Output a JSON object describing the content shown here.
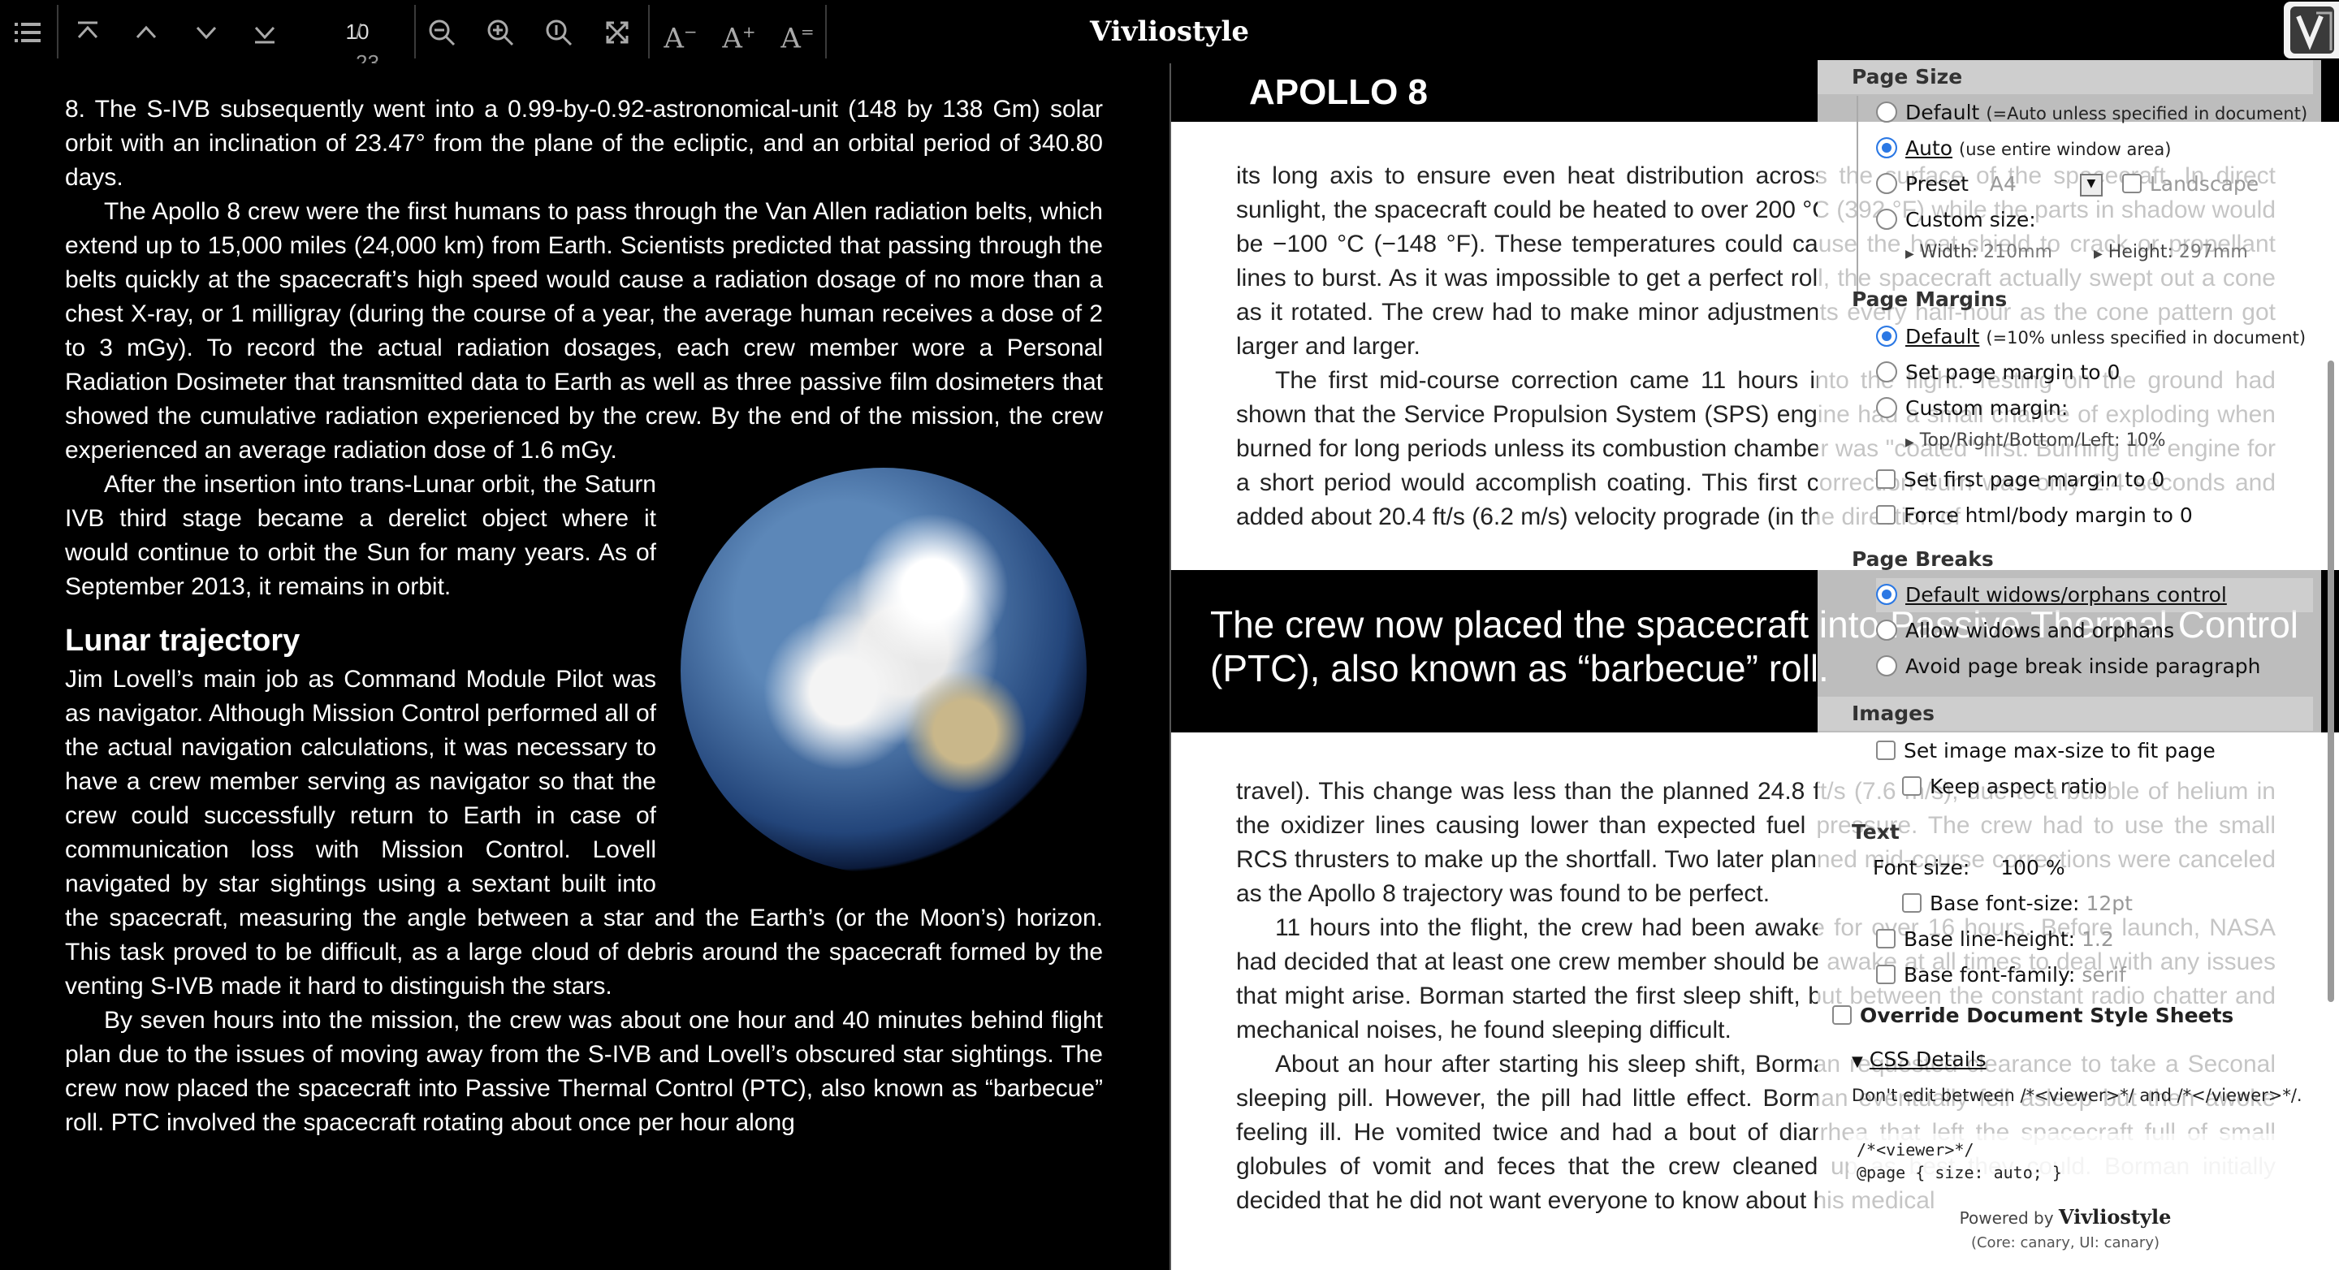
{
  "toolbar": {
    "page_current": "10",
    "page_total": "/ 23",
    "title": "Vivliostyle",
    "icons": [
      "menu-icon",
      "first-page-icon",
      "prev-page-icon",
      "next-page-icon",
      "last-page-icon",
      "zoom-out-icon",
      "zoom-in-icon",
      "zoom-actual-icon",
      "fit-page-icon",
      "font-smaller-icon",
      "font-larger-icon",
      "font-reset-icon"
    ]
  },
  "left_page": {
    "p1": "8. The S-IVB subsequently went into a 0.99-by-0.92-astronomical-unit (148 by 138 Gm) solar orbit with an inclination of 23.47° from the plane of the ecliptic, and an orbital period of 340.80 days.",
    "p2": "The Apollo 8 crew were the first humans to pass through the Van Allen radiation belts, which extend up to 15,000 miles (24,000 km) from Earth. Scientists predicted that passing through the belts quickly at the spacecraft’s high speed would cause a radiation dosage of no more than a chest X-ray, or 1 milligray (during the course of a year, the average human receives a dose of 2 to 3 mGy). To record the actual radiation dosages, each crew member wore a Personal Radiation Dosimeter that transmitted data to Earth as well as three passive film dosimeters that showed the cumulative radiation experienced by the crew. By the end of the mission, the crew experienced an average radiation dose of 1.6 mGy.",
    "p3": "After the insertion into trans-Lunar orbit, the Saturn IVB third stage became a derelict object where it would continue to orbit the Sun for many years. As of September 2013, it remains in orbit.",
    "heading": "Lunar trajectory",
    "p4": "Jim Lovell’s main job as Command Module Pilot was as navigator. Although Mission Control performed all of the actual navigation calculations, it was necessary to have a crew member serving as navigator so that the crew could successfully return to Earth in case of communication loss with Mission Control. Lovell navigated by star sightings using a sextant built into the spacecraft, measuring the angle between a star and the Earth’s (or the Moon’s) horizon. This task proved to be difficult, as a large cloud of debris around the spacecraft formed by the venting S-IVB made it hard to distinguish the stars.",
    "p5": "By seven hours into the mission, the crew was about one hour and 40 minutes behind flight plan due to the issues of moving away from the S-IVB and Lovell’s obscured star sightings. The crew now placed the spacecraft into Passive Thermal Control (PTC), also known as “barbecue” roll. PTC involved the spacecraft rotating about once per hour along"
  },
  "right_page": {
    "running_head": "APOLLO 8",
    "p1": "its long axis to ensure even heat distribution across the surface of the spacecraft. In direct sunlight, the spacecraft could be heated to over 200 °C (392 °F) while the parts in shadow would be −100 °C (−148 °F). These temperatures could cause the heat shield to crack or propellant lines to burst. As it was impossible to get a perfect roll, the spacecraft actually swept out a cone as it rotated. The crew had to make minor adjustments every half-hour as the cone pattern got larger and larger.",
    "p2": "The first mid-course correction came 11 hours into the flight. Testing on the ground had shown that the Service Propulsion System (SPS) engine had a small chance of exploding when burned for long periods unless its combustion chamber was \"coated\" first. Burning the engine for a short period would accomplish coating. This first correction burn was only 2.4 seconds and added about 20.4 ft/s (6.2 m/s) velocity prograde (in the direction of",
    "pull_quote": "The crew now placed the spacecraft into Passive Thermal Control (PTC), also known as “barbecue” roll.",
    "p3": "travel). This change was less than the planned 24.8 ft/s (7.6 m/s), due to a bubble of helium in the oxidizer lines causing lower than expected fuel pressure. The crew had to use the small RCS thrusters to make up the shortfall. Two later planned mid-course corrections were canceled as the Apollo 8 trajectory was found to be perfect.",
    "p4": "11 hours into the flight, the crew had been awake for over 16 hours. Before launch, NASA had decided that at least one crew member should be awake at all times to deal with any issues that might arise. Borman started the first sleep shift, but between the constant radio chatter and mechanical noises, he found sleeping difficult.",
    "p5": "About an hour after starting his sleep shift, Borman requested clearance to take a Seconal sleeping pill. However, the pill had little effect. Borman eventually fell asleep but then awoke feeling ill. He vomited twice and had a bout of diarrhea that left the spacecraft full of small globules of vomit and feces that the crew cleaned up as best they could. Borman initially decided that he did not want everyone to know about his medical"
  },
  "settings": {
    "page_size": {
      "heading": "Page Size",
      "default_label": "Default",
      "default_note": "(=Auto unless specified in document)",
      "auto_label": "Auto",
      "auto_note": "(use entire window area)",
      "preset_label": "Preset",
      "preset_value": "A4",
      "landscape_label": "Landscape",
      "custom_label": "Custom size:",
      "width_label": "Width:",
      "width_value": "210mm",
      "height_label": "Height:",
      "height_value": "297mm",
      "selected": "auto"
    },
    "page_margins": {
      "heading": "Page Margins",
      "default_label": "Default",
      "default_note": "(=10% unless specified in document)",
      "zero_label": "Set page margin to 0",
      "custom_label": "Custom margin:",
      "trbl_label": "Top/Right/Bottom/Left:",
      "trbl_value": "10%",
      "first_page_label": "Set first page margin to 0",
      "force_html_label": "Force html/body margin to 0"
    },
    "page_breaks": {
      "heading": "Page Breaks",
      "default_label": "Default widows/orphans control",
      "allow_label": "Allow widows and orphans",
      "avoid_label": "Avoid page break inside paragraph"
    },
    "images": {
      "heading": "Images",
      "max_size_label": "Set image max-size to fit page",
      "aspect_label": "Keep aspect ratio"
    },
    "text": {
      "heading": "Text",
      "font_size_label": "Font size:",
      "font_size_value": "100 %",
      "base_font_size_label": "Base font-size:",
      "base_font_size_value": "12pt",
      "base_line_height_label": "Base line-height:",
      "base_line_height_value": "1.2",
      "base_font_family_label": "Base font-family:",
      "base_font_family_value": "serif"
    },
    "override_label": "Override Document Style Sheets",
    "css_details_label": "CSS Details",
    "css_note": "Don't edit between /*<viewer>*/ and /*</viewer>*/.",
    "css_line1": "/*<viewer>*/",
    "css_line2": "@page { size: auto; }",
    "powered_prefix": "Powered by",
    "powered_brand": "Vivliostyle",
    "version": "(Core: canary, UI: canary)"
  },
  "colors": {
    "accent": "#2b78e4",
    "toolbar_bg": "#000000",
    "left_page_bg": "#000000",
    "right_page_bg": "#ffffff"
  }
}
